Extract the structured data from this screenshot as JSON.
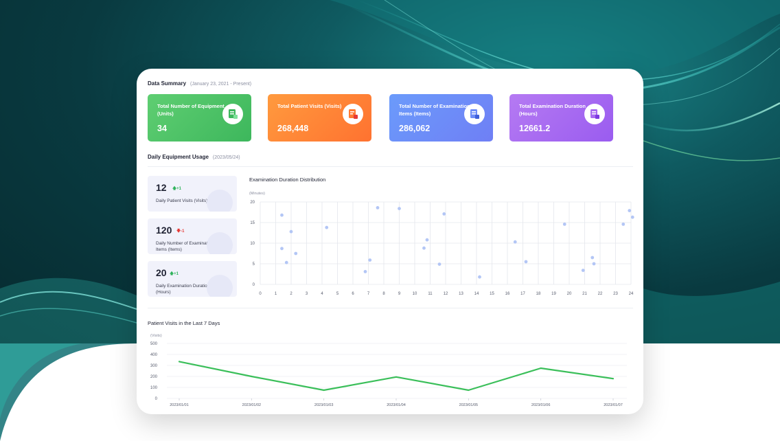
{
  "summary": {
    "title": "Data Summary",
    "range": "(January 23, 2021 - Present)",
    "cards": [
      {
        "label": "Total Number of Equipment (Units)",
        "value": "34",
        "icon": "equipment-icon",
        "color": "#47c262"
      },
      {
        "label": "Total Patient Visits (Visits)",
        "value": "268,448",
        "icon": "patient-record-icon",
        "color": "#ff8436"
      },
      {
        "label": "Total Number of Examination Items (Items)",
        "value": "286,062",
        "icon": "exam-items-icon",
        "color": "#6d8cf8"
      },
      {
        "label": "Total Examination Duration (Hours)",
        "value": "12661.2",
        "icon": "duration-icon",
        "color": "#a86af1"
      }
    ]
  },
  "daily": {
    "title": "Daily Equipment Usage",
    "date": "(2023/05/24)",
    "items": [
      {
        "value": "12",
        "change": "+1",
        "direction": "up",
        "label": "Daily Patient Visits (Visits)"
      },
      {
        "value": "120",
        "change": "-1",
        "direction": "down",
        "label": "Daily Number of Examination Items (Items)"
      },
      {
        "value": "20",
        "change": "+1",
        "direction": "up",
        "label": "Daily Examination Duration (Hours)"
      }
    ]
  },
  "chart_data": [
    {
      "type": "scatter",
      "title": "Examination Duration Distribution",
      "ylabel": "(Minutes)",
      "xlim": [
        0,
        24
      ],
      "ylim": [
        0,
        20
      ],
      "x_ticks": [
        0,
        1,
        2,
        3,
        4,
        5,
        6,
        7,
        8,
        9,
        10,
        11,
        12,
        13,
        14,
        15,
        16,
        17,
        18,
        19,
        20,
        21,
        22,
        23,
        24
      ],
      "y_ticks": [
        0,
        5,
        10,
        15,
        20
      ],
      "grid": true,
      "color": "#b3c6f5",
      "points": [
        [
          1.4,
          16.8
        ],
        [
          1.4,
          8.7
        ],
        [
          1.7,
          5.3
        ],
        [
          2.0,
          12.8
        ],
        [
          2.3,
          7.5
        ],
        [
          4.3,
          13.8
        ],
        [
          6.8,
          3.1
        ],
        [
          7.1,
          5.9
        ],
        [
          7.6,
          18.6
        ],
        [
          9.0,
          18.4
        ],
        [
          10.6,
          8.8
        ],
        [
          10.8,
          10.8
        ],
        [
          11.6,
          4.9
        ],
        [
          11.9,
          17.1
        ],
        [
          14.2,
          1.8
        ],
        [
          16.5,
          10.3
        ],
        [
          17.2,
          5.5
        ],
        [
          19.7,
          14.6
        ],
        [
          20.9,
          3.4
        ],
        [
          21.5,
          6.5
        ],
        [
          21.6,
          5.0
        ],
        [
          23.5,
          14.6
        ],
        [
          23.9,
          17.9
        ],
        [
          24.1,
          16.3
        ]
      ]
    },
    {
      "type": "line",
      "title": "Patient Visits in the Last 7 Days",
      "ylabel": "(Visits)",
      "x": [
        "2023/01/01",
        "2023/01/02",
        "2023/01/03",
        "2023/01/04",
        "2023/01/05",
        "2023/01/06",
        "2023/01/07"
      ],
      "values": [
        335,
        200,
        75,
        195,
        75,
        275,
        180
      ],
      "ylim": [
        0,
        500
      ],
      "y_ticks": [
        0,
        100,
        200,
        300,
        400,
        500
      ],
      "grid": true,
      "color": "#3bbf5a"
    }
  ]
}
